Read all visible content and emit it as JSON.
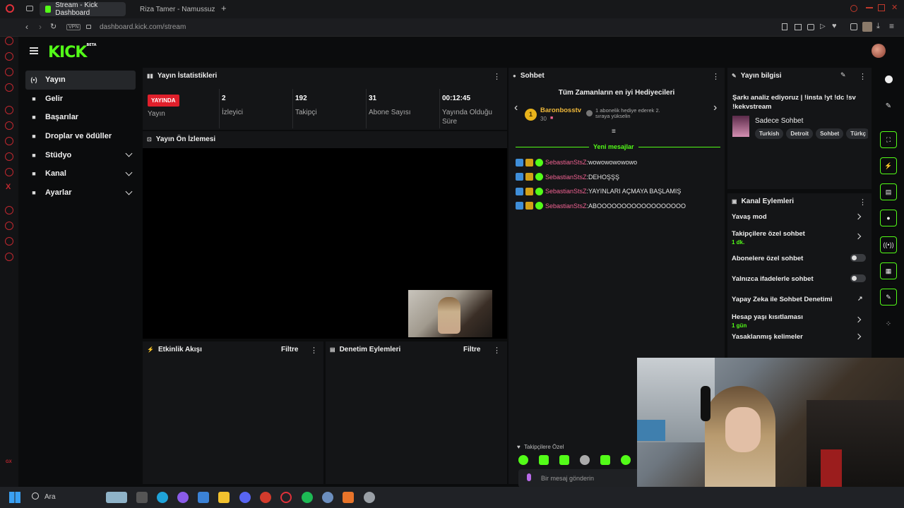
{
  "browser": {
    "tabs": [
      {
        "label": "Stream - Kick Dashboard",
        "active": true,
        "icon": "kick-icon"
      },
      {
        "label": "Riza Tamer - Namussuz S",
        "active": false,
        "icon": "youtube-icon"
      }
    ],
    "vpn_label": "VPN",
    "url": "dashboard.kick.com/stream"
  },
  "kick": {
    "logo": "KICK",
    "logo_badge": "BETA"
  },
  "nav": {
    "items": [
      {
        "label": "Yayın",
        "icon": "stream-icon",
        "active": true,
        "expandable": false
      },
      {
        "label": "Gelir",
        "icon": "revenue-icon",
        "active": false,
        "expandable": false
      },
      {
        "label": "Başarılar",
        "icon": "trophy-icon",
        "active": false,
        "expandable": false
      },
      {
        "label": "Droplar ve ödüller",
        "icon": "drops-icon",
        "active": false,
        "expandable": false
      },
      {
        "label": "Stüdyo",
        "icon": "studio-icon",
        "active": false,
        "expandable": true
      },
      {
        "label": "Kanal",
        "icon": "channel-icon",
        "active": false,
        "expandable": true
      },
      {
        "label": "Ayarlar",
        "icon": "gear-icon",
        "active": false,
        "expandable": true
      }
    ]
  },
  "stats": {
    "title": "Yayın İstatistikleri",
    "live_badge": "YAYINDA",
    "live_label": "Yayın",
    "viewers_value": "2",
    "viewers_label": "İzleyici",
    "followers_value": "192",
    "followers_label": "Takipçi",
    "subs_value": "31",
    "subs_label": "Abone Sayısı",
    "uptime_value": "00:12:45",
    "uptime_label": "Yayında Olduğu Süre"
  },
  "preview": {
    "title": "Yayın Ön İzlemesi"
  },
  "activity": {
    "title": "Etkinlik Akışı",
    "filter": "Filtre"
  },
  "moderation": {
    "title": "Denetim Eylemleri",
    "filter": "Filtre"
  },
  "chat": {
    "title": "Sohbet",
    "gifters_title": "Tüm Zamanların en iyi Hediyecileri",
    "gifter_rank": "1",
    "gifter_name": "Baronbosstv",
    "gifter_count": "30",
    "gifter_note": "1 abonelik hediye ederek 2. sıraya yükselin",
    "new_messages": "Yeni mesajlar",
    "messages": [
      {
        "user": "SebastianStsZ",
        "text": "wowowowowowo"
      },
      {
        "user": "SebastianStsZ",
        "text": "DEHOŞŞŞ"
      },
      {
        "user": "SebastianStsZ",
        "text": "YAYINLARI AÇMAYA BAŞLAMIŞ"
      },
      {
        "user": "SebastianStsZ",
        "text": "ABOOOOOOOOOOOOOOOOOO"
      }
    ],
    "follower_mode": "Takipçilere Özel",
    "input_placeholder": "Bir mesaj gönderin",
    "points": "0"
  },
  "stream_info": {
    "title": "Yayın bilgisi",
    "stream_title": "Şarkı analiz ediyoruz | !insta !yt !dc !sv !kekvstream",
    "category": "Sadece Sohbet",
    "tags": [
      "Turkish",
      "Detroit",
      "Sohbet",
      "Türkç"
    ]
  },
  "channel_actions": {
    "title": "Kanal Eylemleri",
    "items": [
      {
        "label": "Yavaş mod",
        "sub": "",
        "control": "chevron"
      },
      {
        "label": "Takipçilere özel sohbet",
        "sub": "1 dk.",
        "control": "chevron"
      },
      {
        "label": "Abonelere özel sohbet",
        "sub": "",
        "control": "toggle"
      },
      {
        "label": "Yalnızca ifadelerle sohbet",
        "sub": "",
        "control": "toggle"
      },
      {
        "label": "Yapay Zeka ile Sohbet Denetimi",
        "sub": "",
        "control": "external"
      },
      {
        "label": "Hesap yaşı kısıtlaması",
        "sub": "1 gün",
        "control": "chevron"
      },
      {
        "label": "Yasaklanmış kelimeler",
        "sub": "",
        "control": "chevron"
      }
    ]
  },
  "taskbar": {
    "search_label": "Ara"
  },
  "colors": {
    "accent": "#53fc18",
    "live": "#e01f2b",
    "username": "#f06292",
    "panel": "#141517"
  }
}
